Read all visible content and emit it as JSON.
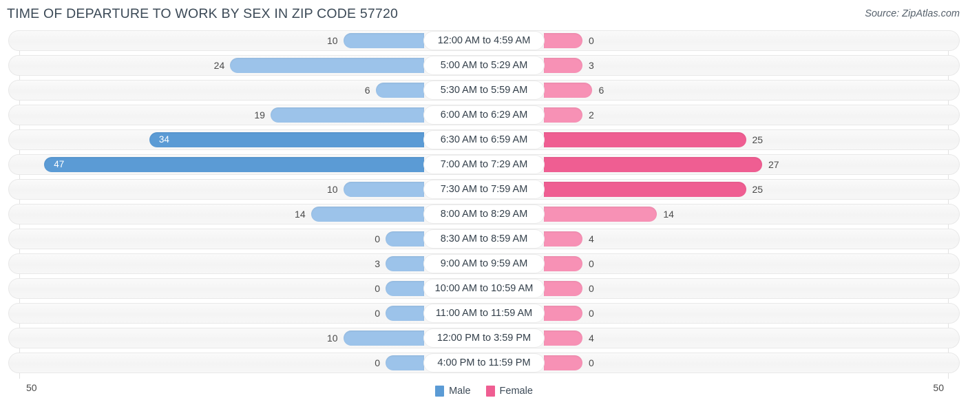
{
  "header": {
    "title": "TIME OF DEPARTURE TO WORK BY SEX IN ZIP CODE 57720",
    "source": "Source: ZipAtlas.com"
  },
  "legend": {
    "male_label": "Male",
    "female_label": "Female",
    "male_color": "#5b9bd5",
    "female_color": "#ef5e92"
  },
  "axis": {
    "left_tick": "50",
    "right_tick": "50"
  },
  "colors": {
    "male_light": "#9cc3ea",
    "male_strong": "#5b9bd5",
    "female_light": "#f791b5",
    "female_strong": "#ef5e92"
  },
  "chart_data": {
    "type": "bar",
    "subtype": "diverging-butterfly",
    "title": "TIME OF DEPARTURE TO WORK BY SEX IN ZIP CODE 57720",
    "xlabel": "",
    "ylabel": "",
    "xlim": [
      -50,
      50
    ],
    "axis_tick_labels": [
      "50",
      "50"
    ],
    "grid": false,
    "legend_position": "bottom-center",
    "categories": [
      "12:00 AM to 4:59 AM",
      "5:00 AM to 5:29 AM",
      "5:30 AM to 5:59 AM",
      "6:00 AM to 6:29 AM",
      "6:30 AM to 6:59 AM",
      "7:00 AM to 7:29 AM",
      "7:30 AM to 7:59 AM",
      "8:00 AM to 8:29 AM",
      "8:30 AM to 8:59 AM",
      "9:00 AM to 9:59 AM",
      "10:00 AM to 10:59 AM",
      "11:00 AM to 11:59 AM",
      "12:00 PM to 3:59 PM",
      "4:00 PM to 11:59 PM"
    ],
    "series": [
      {
        "name": "Male",
        "values": [
          10,
          24,
          6,
          19,
          34,
          47,
          10,
          14,
          0,
          3,
          0,
          0,
          10,
          0
        ]
      },
      {
        "name": "Female",
        "values": [
          0,
          3,
          6,
          2,
          25,
          27,
          25,
          14,
          4,
          0,
          0,
          0,
          4,
          0
        ]
      }
    ]
  },
  "rows": [
    {
      "category": "12:00 AM to 4:59 AM",
      "male": 10,
      "female": 0,
      "male_text": "10",
      "female_text": "0"
    },
    {
      "category": "5:00 AM to 5:29 AM",
      "male": 24,
      "female": 3,
      "male_text": "24",
      "female_text": "3"
    },
    {
      "category": "5:30 AM to 5:59 AM",
      "male": 6,
      "female": 6,
      "male_text": "6",
      "female_text": "6"
    },
    {
      "category": "6:00 AM to 6:29 AM",
      "male": 19,
      "female": 2,
      "male_text": "19",
      "female_text": "2"
    },
    {
      "category": "6:30 AM to 6:59 AM",
      "male": 34,
      "female": 25,
      "male_text": "34",
      "female_text": "25"
    },
    {
      "category": "7:00 AM to 7:29 AM",
      "male": 47,
      "female": 27,
      "male_text": "47",
      "female_text": "27"
    },
    {
      "category": "7:30 AM to 7:59 AM",
      "male": 10,
      "female": 25,
      "male_text": "10",
      "female_text": "25"
    },
    {
      "category": "8:00 AM to 8:29 AM",
      "male": 14,
      "female": 14,
      "male_text": "14",
      "female_text": "14"
    },
    {
      "category": "8:30 AM to 8:59 AM",
      "male": 0,
      "female": 4,
      "male_text": "0",
      "female_text": "4"
    },
    {
      "category": "9:00 AM to 9:59 AM",
      "male": 3,
      "female": 0,
      "male_text": "3",
      "female_text": "0"
    },
    {
      "category": "10:00 AM to 10:59 AM",
      "male": 0,
      "female": 0,
      "male_text": "0",
      "female_text": "0"
    },
    {
      "category": "11:00 AM to 11:59 AM",
      "male": 0,
      "female": 0,
      "male_text": "0",
      "female_text": "0"
    },
    {
      "category": "12:00 PM to 3:59 PM",
      "male": 10,
      "female": 4,
      "male_text": "10",
      "female_text": "4"
    },
    {
      "category": "4:00 PM to 11:59 PM",
      "male": 0,
      "female": 0,
      "male_text": "0",
      "female_text": "0"
    }
  ]
}
